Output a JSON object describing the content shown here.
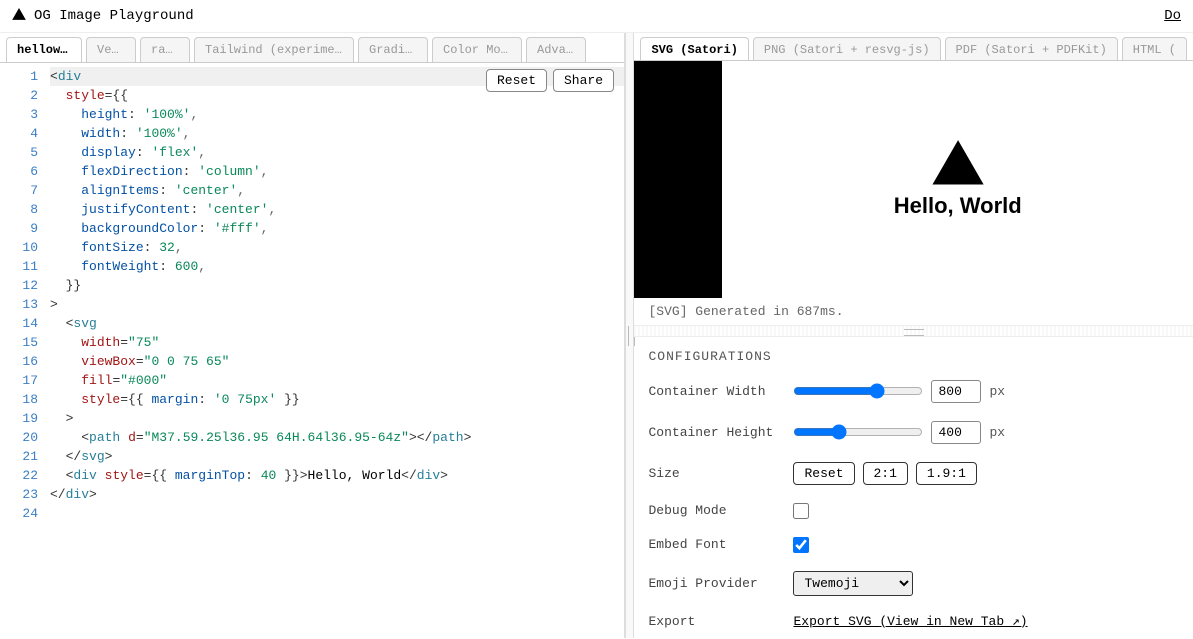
{
  "header": {
    "title": "OG Image Playground",
    "right_link": "Do"
  },
  "editor_tabs": [
    {
      "label": "hellowor…",
      "active": true
    },
    {
      "label": "Verc…",
      "active": false
    },
    {
      "label": "rauc…",
      "active": false
    },
    {
      "label": "Tailwind (experiment…",
      "active": false
    },
    {
      "label": "Gradien…",
      "active": false
    },
    {
      "label": "Color Mode…",
      "active": false
    },
    {
      "label": "Advanc…",
      "active": false
    }
  ],
  "editor_buttons": {
    "reset": "Reset",
    "share": "Share"
  },
  "code": {
    "lines": 24,
    "l1": {
      "p1": "<",
      "tag": "div"
    },
    "l2": {
      "attr": "style",
      "p1": "={{"
    },
    "l3": {
      "prop": "height",
      "str": "'100%'"
    },
    "l4": {
      "prop": "width",
      "str": "'100%'"
    },
    "l5": {
      "prop": "display",
      "str": "'flex'"
    },
    "l6": {
      "prop": "flexDirection",
      "str": "'column'"
    },
    "l7": {
      "prop": "alignItems",
      "str": "'center'"
    },
    "l8": {
      "prop": "justifyContent",
      "str": "'center'"
    },
    "l9": {
      "prop": "backgroundColor",
      "str": "'#fff'"
    },
    "l10": {
      "prop": "fontSize",
      "num": "32"
    },
    "l11": {
      "prop": "fontWeight",
      "num": "600"
    },
    "l12": {
      "p1": "}}"
    },
    "l13": {
      "p1": ">"
    },
    "l14": {
      "p1": "<",
      "tag": "svg"
    },
    "l15": {
      "attr": "width",
      "str": "\"75\""
    },
    "l16": {
      "attr": "viewBox",
      "str": "\"0 0 75 65\""
    },
    "l17": {
      "attr": "fill",
      "str": "\"#000\""
    },
    "l18": {
      "attr": "style",
      "p1": "={{ ",
      "prop": "margin",
      "str": "'0 75px'",
      "p2": " }}"
    },
    "l19": {
      "p1": ">"
    },
    "l20": {
      "p1": "<",
      "tag1": "path",
      "attr": "d",
      "str": "\"M37.59.25l36.95 64H.64l36.95-64z\"",
      "p2": "></",
      "tag2": "path",
      "p3": ">"
    },
    "l21": {
      "p1": "</",
      "tag": "svg",
      "p2": ">"
    },
    "l22": {
      "p1": "<",
      "tag1": "div",
      "attr": "style",
      "p2": "={{ ",
      "prop": "marginTop",
      "num": "40",
      "p3": " }}>",
      "text": "Hello, World",
      "p4": "</",
      "tag2": "div",
      "p5": ">"
    },
    "l23": {
      "p1": "</",
      "tag": "div",
      "p2": ">"
    }
  },
  "preview_tabs": [
    {
      "label": "SVG (Satori)",
      "active": true
    },
    {
      "label": "PNG (Satori + resvg-js)",
      "active": false
    },
    {
      "label": "PDF (Satori + PDFKit)",
      "active": false
    },
    {
      "label": "HTML (",
      "active": false
    }
  ],
  "preview": {
    "hello": "Hello, World"
  },
  "status": "[SVG] Generated in 687ms.",
  "config": {
    "title": "CONFIGURATIONS",
    "width_label": "Container Width",
    "width_value": "800",
    "height_label": "Container Height",
    "height_value": "400",
    "unit": "px",
    "size_label": "Size",
    "size_reset": "Reset",
    "size_21": "2:1",
    "size_191": "1.9:1",
    "debug_label": "Debug Mode",
    "debug_checked": false,
    "embed_label": "Embed Font",
    "embed_checked": true,
    "emoji_label": "Emoji Provider",
    "emoji_value": "Twemoji",
    "export_label": "Export",
    "export_link": "Export SVG",
    "export_view": "(View in New Tab ↗)"
  }
}
